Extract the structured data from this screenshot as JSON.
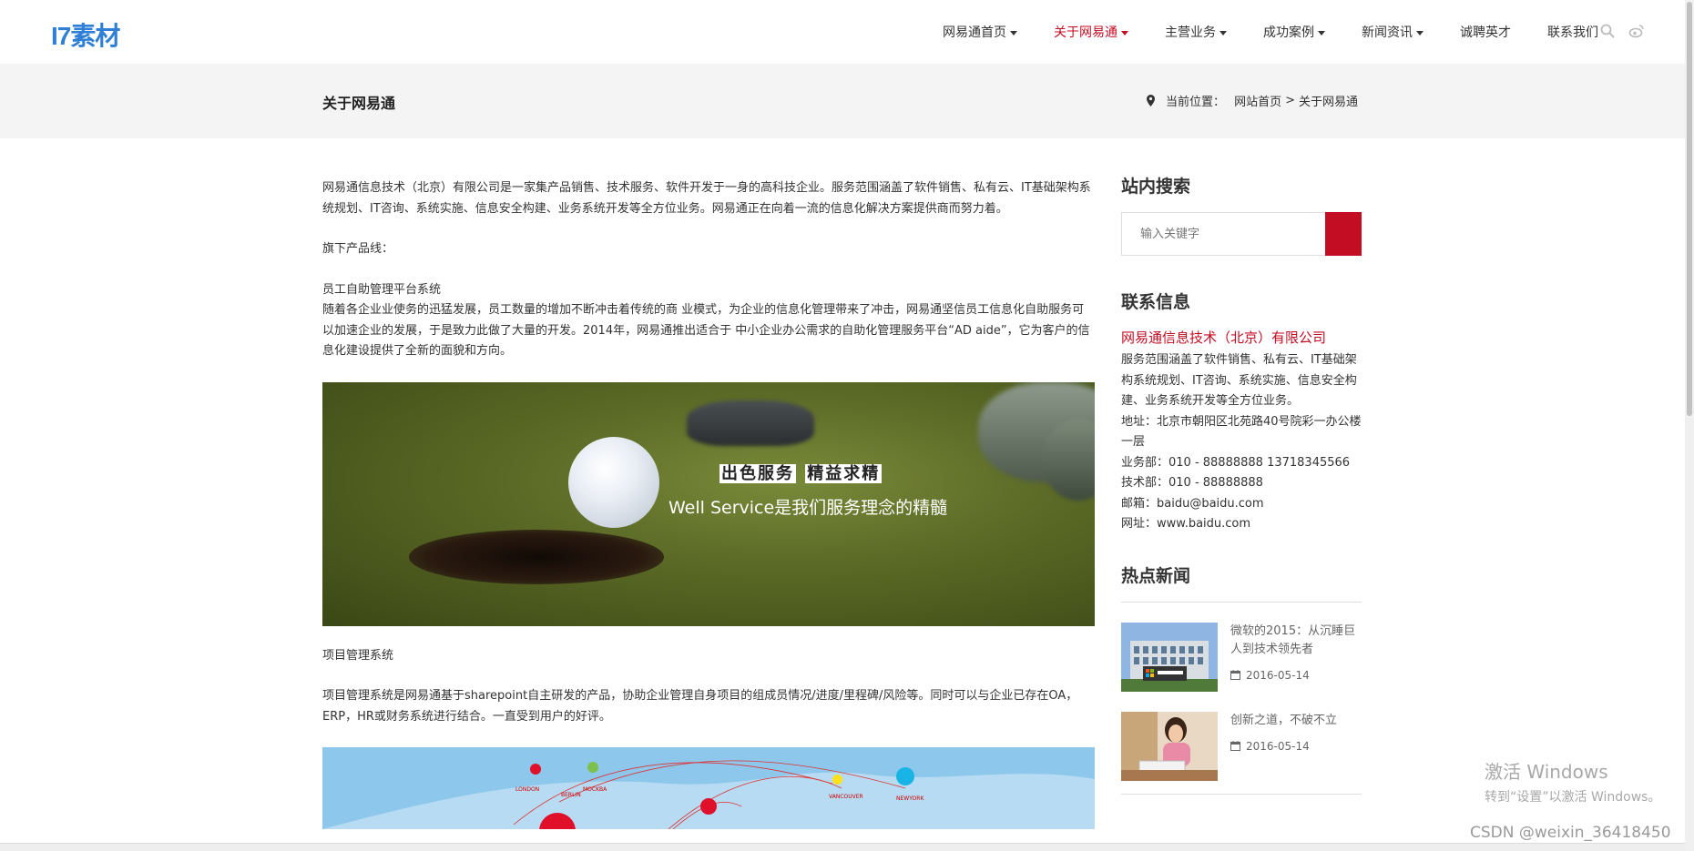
{
  "logo": {
    "text": "I7素材"
  },
  "nav": {
    "items": [
      {
        "label": "网易通首页",
        "dropdown": true,
        "active": false
      },
      {
        "label": "关于网易通",
        "dropdown": true,
        "active": true
      },
      {
        "label": "主营业务",
        "dropdown": true,
        "active": false
      },
      {
        "label": "成功案例",
        "dropdown": true,
        "active": false
      },
      {
        "label": "新闻资讯",
        "dropdown": true,
        "active": false
      },
      {
        "label": "诚聘英才",
        "dropdown": false,
        "active": false
      },
      {
        "label": "联系我们",
        "dropdown": false,
        "active": false
      }
    ],
    "icons": [
      "search-icon",
      "weibo-icon"
    ]
  },
  "titlebar": {
    "title": "关于网易通",
    "breadcrumb_label": "当前位置：",
    "crumb_home": "网站首页",
    "separator": ">",
    "crumb_current": "关于网易通"
  },
  "main": {
    "intro": "网易通信息技术（北京）有限公司是一家集产品销售、技术服务、软件开发于一身的高科技企业。服务范围涵盖了软件销售、私有云、IT基础架构系统规划、IT咨询、系统实施、信息安全构建、业务系统开发等全方位业务。网易通正在向着一流的信息化解决方案提供商而努力着。",
    "products_heading": "旗下产品线：",
    "product1_title": "员工自助管理平台系统",
    "product1_desc": "随着各企业业使务的迅猛发展，员工数量的增加不断冲击着传统的商 业模式，为企业的信息化管理带来了冲击，网易通坚信员工信息化自助服务可以加速企业的发展，于是致力此做了大量的开发。2014年，网易通推出适合于 中小企业办公需求的自助化管理服务平台“AD aide”，它为客户的信息化建设提供了全新的面貌和方向。",
    "banner": {
      "line1a": "出色服务",
      "line1b": "精益求精",
      "line2": "Well Service是我们服务理念的精髓"
    },
    "product2_title": "项目管理系统",
    "product2_desc": "项目管理系统是网易通基于sharepoint自主研发的产品，协助企业管理自身项目的组成员情况/进度/里程碑/风险等。同时可以与企业已存在OA，ERP，HR或财务系统进行结合。一直受到用户的好评。",
    "map_cities": [
      "LONDON",
      "MOCKBA",
      "BERLIN",
      "VANCOUVER",
      "NEWYORK"
    ]
  },
  "sidebar": {
    "search_heading": "站内搜索",
    "search_placeholder": "输入关键字",
    "contact_heading": "联系信息",
    "company": "网易通信息技术（北京）有限公司",
    "services": "服务范围涵盖了软件销售、私有云、IT基础架构系统规划、IT咨询、系统实施、信息安全构建、业务系统开发等全方位业务。",
    "address": "地址：北京市朝阳区北苑路40号院彩一办公楼一层",
    "business": "业务部：010 - 88888888 13718345566",
    "tech": "技术部：010 - 88888888",
    "email": "邮箱：baidu@baidu.com",
    "website": "网址：www.baidu.com",
    "hot_heading": "热点新闻",
    "news": [
      {
        "title": "微软的2015：从沉睡巨人到技术领先者",
        "date": "2016-05-14"
      },
      {
        "title": "创新之道，不破不立",
        "date": "2016-05-14"
      }
    ]
  },
  "overlay": {
    "activate_title": "激活 Windows",
    "activate_sub": "转到“设置”以激活 Windows。",
    "csdn": "CSDN @weixin_36418450"
  },
  "colors": {
    "accent": "#c30d23",
    "logo": "#2f7fd6",
    "titlebar_bg": "#f4f4f4"
  }
}
